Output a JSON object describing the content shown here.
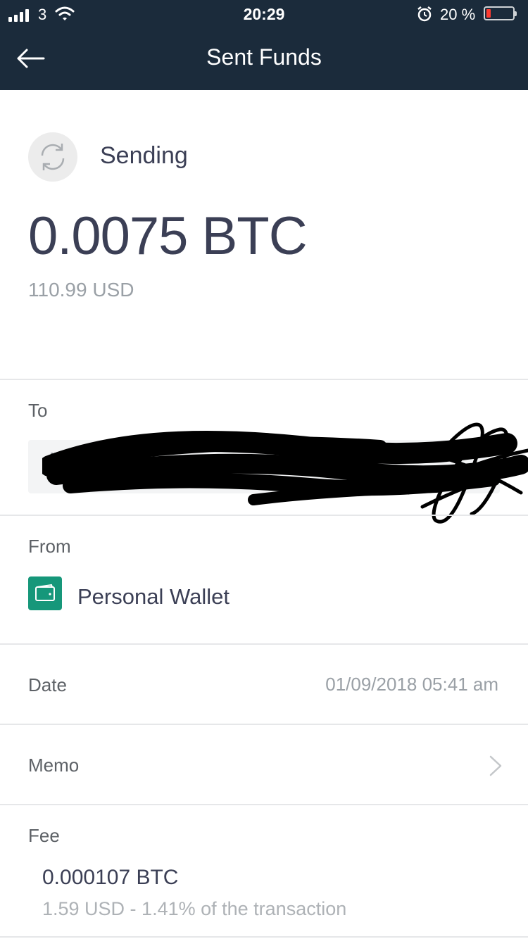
{
  "status_bar": {
    "carrier": "3",
    "time": "20:29",
    "battery_percent": "20 %",
    "battery_level": 0.2,
    "icons": [
      "signal-icon",
      "wifi-icon",
      "alarm-icon",
      "battery-icon"
    ]
  },
  "header": {
    "title": "Sent Funds",
    "back_icon": "back-arrow-icon"
  },
  "transaction": {
    "status": "Sending",
    "status_icon": "refresh-icon",
    "amount_value": "0.0075",
    "amount_unit": "BTC",
    "fiat": "110.99 USD"
  },
  "to": {
    "label": "To",
    "currency_glyph": "₿",
    "address": "",
    "redacted": true
  },
  "from": {
    "label": "From",
    "wallet_icon": "wallet-icon",
    "wallet_name": "Personal Wallet"
  },
  "date": {
    "label": "Date",
    "value": "01/09/2018 05:41 am"
  },
  "memo": {
    "label": "Memo",
    "icon": "chevron-right-icon"
  },
  "fee": {
    "label": "Fee",
    "btc": "0.000107 BTC",
    "detail": "1.59 USD - 1.41% of the transaction"
  },
  "colors": {
    "header_bg": "#1b2b3b",
    "wallet_green": "#16977a",
    "battery_red": "#ff3b30"
  }
}
